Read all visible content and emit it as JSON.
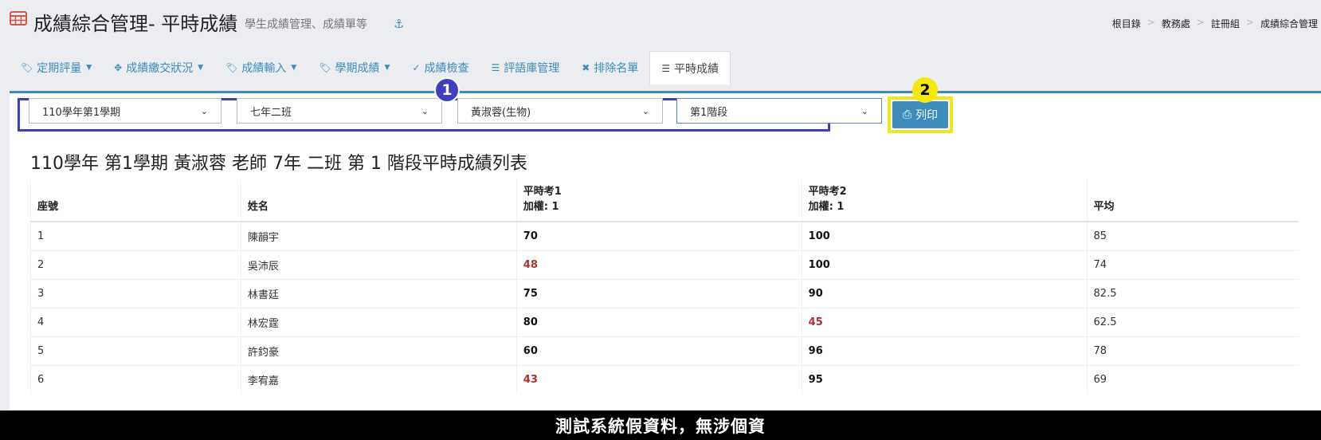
{
  "header": {
    "title": "成績綜合管理- 平時成績",
    "subtitle": "學生成績管理、成績單等",
    "icon": "table-icon",
    "accent": "#d9534f"
  },
  "breadcrumb": [
    "根目錄",
    "教務處",
    "註冊組",
    "成績綜合管理"
  ],
  "tabs": [
    {
      "label": "定期評量",
      "icon": "tags-icon",
      "dropdown": true,
      "active": false
    },
    {
      "label": "成績繳交狀況",
      "icon": "crosshairs-icon",
      "dropdown": true,
      "active": false
    },
    {
      "label": "成績輸入",
      "icon": "tags-icon",
      "dropdown": true,
      "active": false
    },
    {
      "label": "學期成績",
      "icon": "tags-icon",
      "dropdown": true,
      "active": false
    },
    {
      "label": "成績檢查",
      "icon": "check-circle-icon",
      "dropdown": false,
      "active": false
    },
    {
      "label": "評語庫管理",
      "icon": "database-icon",
      "dropdown": false,
      "active": false
    },
    {
      "label": "排除名單",
      "icon": "user-times-icon",
      "dropdown": false,
      "active": false
    },
    {
      "label": "平時成績",
      "icon": "database-icon",
      "dropdown": false,
      "active": true
    }
  ],
  "filters": {
    "semester": "110學年第1學期",
    "class": "七年二班",
    "teacher": "黃淑蓉(生物)",
    "stage": "第1階段"
  },
  "annotations": {
    "badge1": "1",
    "badge2": "2"
  },
  "print_label": "列印",
  "list_title": "110學年 第1學期 黃淑蓉 老師 7年 二班 第 1 階段平時成績列表",
  "table": {
    "headers": {
      "seat": "座號",
      "name": "姓名",
      "quiz1": "平時考1",
      "quiz1_weight": "加權: 1",
      "quiz2": "平時考2",
      "quiz2_weight": "加權: 1",
      "avg": "平均"
    },
    "rows": [
      {
        "seat": "1",
        "name": "陳韻宇",
        "q1": "70",
        "q2": "100",
        "avg": "85"
      },
      {
        "seat": "2",
        "name": "吳沛辰",
        "q1": "48",
        "q2": "100",
        "avg": "74"
      },
      {
        "seat": "3",
        "name": "林書廷",
        "q1": "75",
        "q2": "90",
        "avg": "82.5"
      },
      {
        "seat": "4",
        "name": "林宏霆",
        "q1": "80",
        "q2": "45",
        "avg": "62.5"
      },
      {
        "seat": "5",
        "name": "許鈞豪",
        "q1": "60",
        "q2": "96",
        "avg": "78"
      },
      {
        "seat": "6",
        "name": "李宥嘉",
        "q1": "43",
        "q2": "95",
        "avg": "69"
      }
    ],
    "fail_color": "#b03030"
  },
  "banner": "測試系統假資料，無涉個資"
}
